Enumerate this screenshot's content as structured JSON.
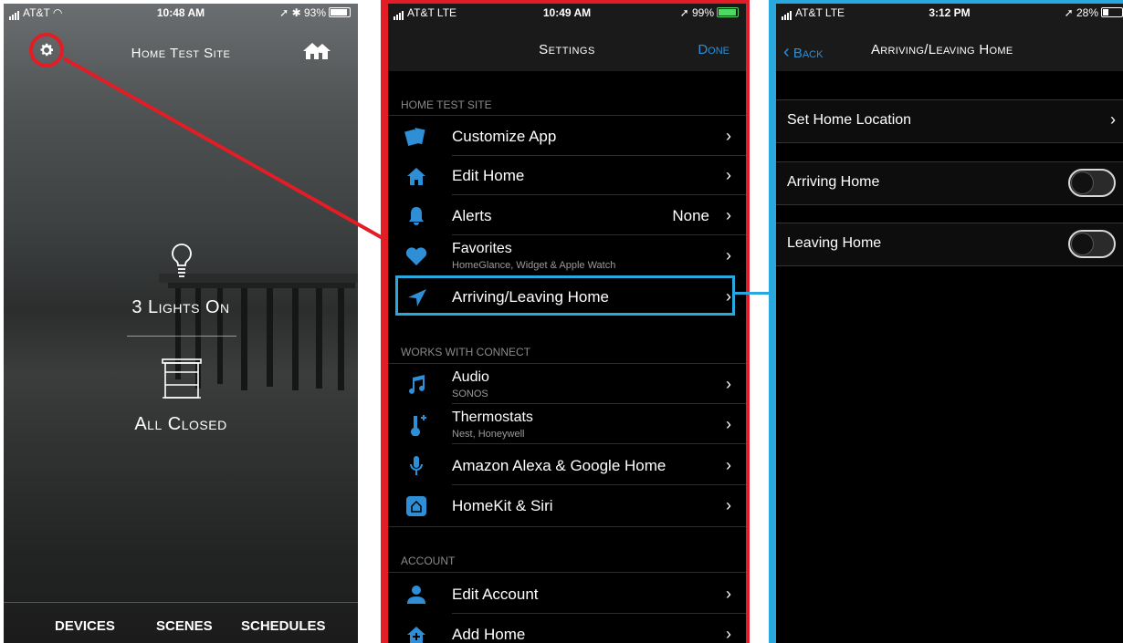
{
  "screen1": {
    "status": {
      "carrier": "AT&T",
      "time": "10:48 AM",
      "battery": "93%"
    },
    "title": "Home Test Site",
    "lights_status": "3 Lights On",
    "shades_status": "All Closed",
    "nav": [
      "DEVICES",
      "SCENES",
      "SCHEDULES"
    ]
  },
  "screen2": {
    "status": {
      "carrier": "AT&T",
      "network": "LTE",
      "time": "10:49 AM",
      "battery": "99%"
    },
    "title": "Settings",
    "done": "Done",
    "sections": [
      {
        "header": "HOME TEST SITE",
        "items": [
          {
            "label": "Customize App",
            "icon": "cards-icon"
          },
          {
            "label": "Edit Home",
            "icon": "house-icon"
          },
          {
            "label": "Alerts",
            "value": "None",
            "icon": "bell-icon"
          },
          {
            "label": "Favorites",
            "sub": "HomeGlance, Widget & Apple Watch",
            "icon": "heart-icon"
          },
          {
            "label": "Arriving/Leaving Home",
            "icon": "location-arrow-icon"
          }
        ]
      },
      {
        "header": "WORKS WITH CONNECT",
        "items": [
          {
            "label": "Audio",
            "sub": "SONOS",
            "icon": "music-note-icon"
          },
          {
            "label": "Thermostats",
            "sub": "Nest, Honeywell",
            "icon": "thermometer-icon"
          },
          {
            "label": "Amazon Alexa & Google Home",
            "icon": "microphone-icon"
          },
          {
            "label": "HomeKit & Siri",
            "icon": "homekit-icon"
          }
        ]
      },
      {
        "header": "ACCOUNT",
        "items": [
          {
            "label": "Edit Account",
            "icon": "user-icon"
          },
          {
            "label": "Add Home",
            "icon": "add-home-icon"
          }
        ]
      }
    ]
  },
  "screen3": {
    "status": {
      "carrier": "AT&T",
      "network": "LTE",
      "time": "3:12 PM",
      "battery": "28%"
    },
    "back": "Back",
    "title": "Arriving/Leaving Home",
    "rows": [
      {
        "label": "Set Home Location"
      },
      {
        "label": "Arriving Home",
        "toggle": false
      },
      {
        "label": "Leaving Home",
        "toggle": false
      }
    ]
  },
  "colors": {
    "red_highlight": "#e21d25",
    "blue_highlight": "#29a8df",
    "accent": "#2e8fd6"
  }
}
